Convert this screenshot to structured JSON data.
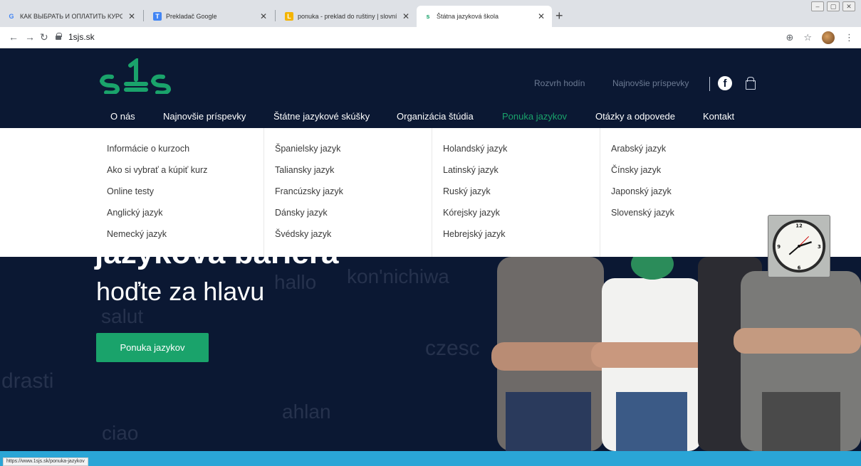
{
  "browser": {
    "tabs": [
      {
        "title": "КАК ВЫБРАТЬ И ОПЛАТИТЬ КУРС",
        "favicon": "G",
        "favicon_color": "#4285f4"
      },
      {
        "title": "Prekladač Google",
        "favicon": "T",
        "favicon_color": "#4285f4"
      },
      {
        "title": "ponuka - preklad do ruštiny | slovník",
        "favicon": "L",
        "favicon_color": "#f4b400"
      },
      {
        "title": "Štátna jazyková škola",
        "favicon": "s",
        "favicon_color": "#1aa36b"
      }
    ],
    "url": "1sjs.sk",
    "new_tab": "+"
  },
  "header": {
    "logo_text": "sjs",
    "top_links": [
      "Rozvrh hodín",
      "Najnovšie príspevky"
    ],
    "nav": [
      "O nás",
      "Najnovšie príspevky",
      "Štátne jazykové skúšky",
      "Organizácia štúdia",
      "Ponuka jazykov",
      "Otázky a odpovede",
      "Kontakt"
    ],
    "active_color": "#1aa36b"
  },
  "mega_menu": [
    [
      "Informácie o kurzoch",
      "Ako si vybrať a kúpiť kurz",
      "Online testy",
      "Anglický jazyk",
      "Nemecký jazyk"
    ],
    [
      "Španielsky jazyk",
      "Taliansky jazyk",
      "Francúzsky jazyk",
      "Dánsky jazyk",
      "Švédsky jazyk"
    ],
    [
      "Holandský jazyk",
      "Latinský jazyk",
      "Ruský jazyk",
      "Kórejsky jazyk",
      "Hebrejský jazyk"
    ],
    [
      "Arabský jazyk",
      "Čínsky jazyk",
      "Japonský jazyk",
      "Slovenský jazyk"
    ]
  ],
  "hero": {
    "title_bold": "jazyková bariéra",
    "title_light": "hoďte za hlavu",
    "cta": "Ponuka jazykov",
    "greetings": [
      "hallo",
      "kon'nichiwa",
      "salut",
      "czesc",
      "drasti",
      "ahlan",
      "ciao"
    ]
  },
  "status_bar": {
    "link": "https://www.1sjs.sk/ponuka-jazykov"
  },
  "colors": {
    "navy": "#0b1833",
    "green": "#1aa36b",
    "blue_strip": "#2aa5d6"
  }
}
